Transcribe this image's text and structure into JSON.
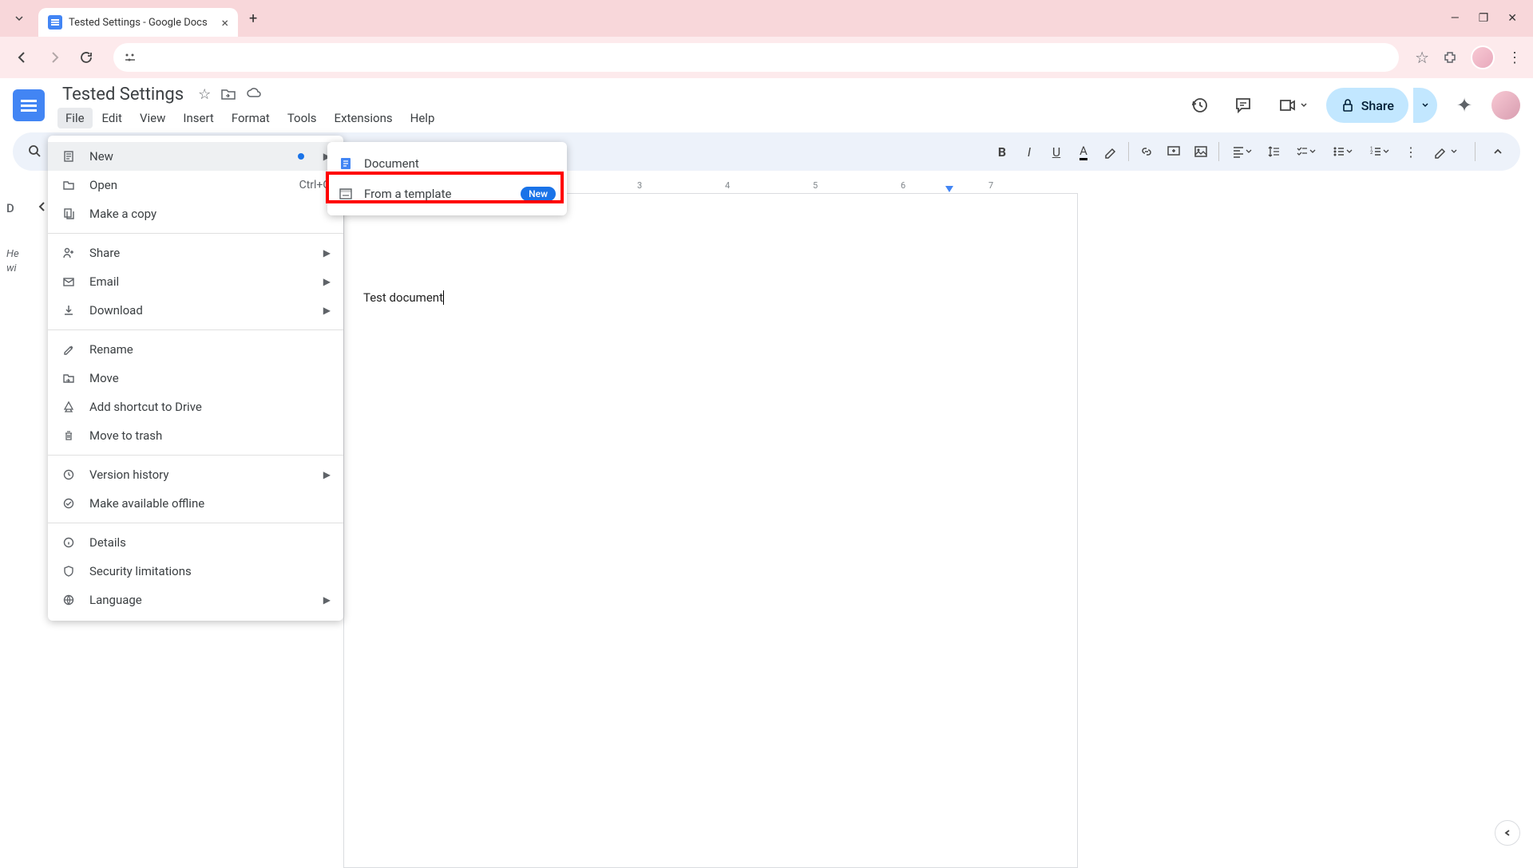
{
  "browser": {
    "tab_title": "Tested Settings - Google Docs"
  },
  "doc": {
    "title": "Tested Settings",
    "content": "Test document"
  },
  "menus": {
    "file": "File",
    "edit": "Edit",
    "view": "View",
    "insert": "Insert",
    "format": "Format",
    "tools": "Tools",
    "extensions": "Extensions",
    "help": "Help"
  },
  "header": {
    "share": "Share"
  },
  "file_menu": {
    "new": "New",
    "open": "Open",
    "open_shortcut": "Ctrl+O",
    "make_copy": "Make a copy",
    "share": "Share",
    "email": "Email",
    "download": "Download",
    "rename": "Rename",
    "move": "Move",
    "add_shortcut": "Add shortcut to Drive",
    "move_trash": "Move to trash",
    "version_history": "Version history",
    "offline": "Make available offline",
    "details": "Details",
    "security": "Security limitations",
    "language": "Language"
  },
  "submenu": {
    "document": "Document",
    "from_template": "From a template",
    "new_badge": "New"
  },
  "outline": {
    "letter": "D",
    "hint": "He\nwi"
  },
  "ruler": {
    "n3": "3",
    "n4": "4",
    "n5": "5",
    "n6": "6",
    "n7": "7"
  }
}
